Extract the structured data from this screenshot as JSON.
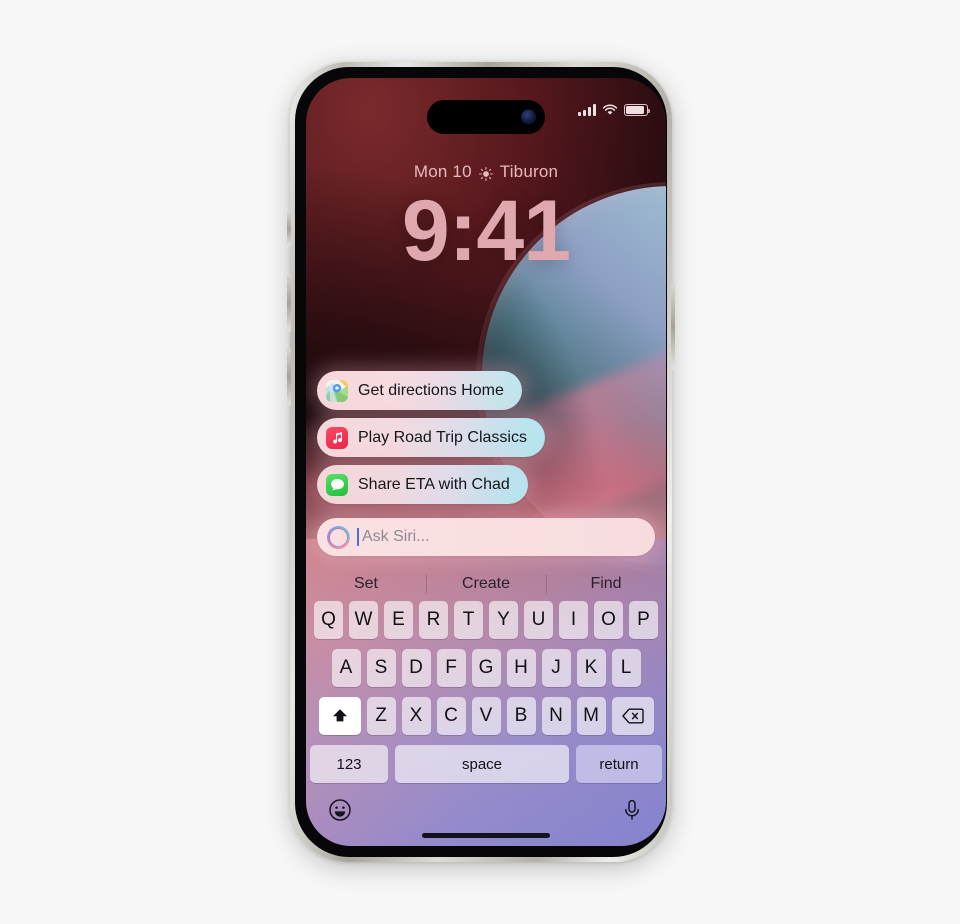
{
  "device": {
    "name": "iPhone",
    "frame_material_color": "#cbc8c2"
  },
  "status_bar": {
    "signal_icon": "cellular-signal-icon",
    "wifi_icon": "wifi-icon",
    "battery_icon": "battery-icon"
  },
  "lock_screen": {
    "date": "Mon 10",
    "weather_icon": "sun-icon",
    "location": "Tiburon",
    "time": "9:41"
  },
  "suggestions": [
    {
      "label": "Get directions Home",
      "icon": "maps-app-icon"
    },
    {
      "label": "Play Road Trip Classics",
      "icon": "music-app-icon"
    },
    {
      "label": "Share ETA with Chad",
      "icon": "messages-app-icon"
    }
  ],
  "siri_field": {
    "icon": "siri-orb-icon",
    "placeholder": "Ask Siri...",
    "value": ""
  },
  "predictive_bar": [
    {
      "label": "Set"
    },
    {
      "label": "Create"
    },
    {
      "label": "Find"
    }
  ],
  "keyboard": {
    "row1": [
      "Q",
      "W",
      "E",
      "R",
      "T",
      "Y",
      "U",
      "I",
      "O",
      "P"
    ],
    "row2": [
      "A",
      "S",
      "D",
      "F",
      "G",
      "H",
      "J",
      "K",
      "L"
    ],
    "row3": [
      "Z",
      "X",
      "C",
      "V",
      "B",
      "N",
      "M"
    ],
    "shift_label": "shift-icon",
    "backspace_label": "backspace-icon",
    "numbers_label": "123",
    "space_label": "space",
    "return_label": "return",
    "emoji_icon": "emoji-icon",
    "dictation_icon": "microphone-icon"
  },
  "colors": {
    "page_background": "#f7f7f7",
    "clock_text": "#dfa8ae",
    "pill_gradient_start": "#f6d7dc",
    "pill_gradient_end": "#bfe4ee",
    "caret": "#4e6fd8"
  }
}
